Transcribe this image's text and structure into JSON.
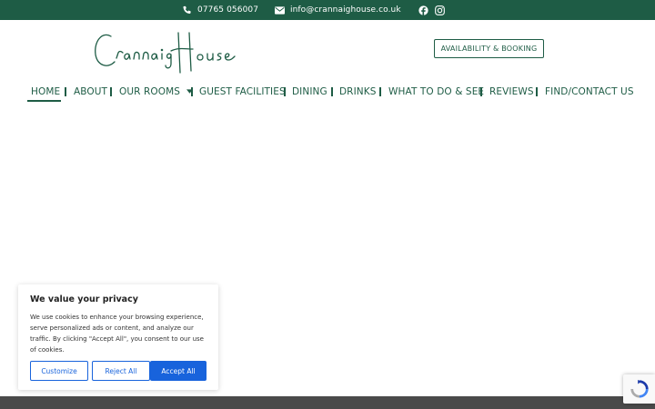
{
  "topbar": {
    "phone": "07765 056007",
    "email": "info@crannaighouse.co.uk",
    "icons": [
      "phone-icon",
      "envelope-icon",
      "facebook-icon",
      "instagram-icon"
    ]
  },
  "header": {
    "logo_text": "Crannaig House",
    "cta_label": "AVAILABILITY & BOOKING"
  },
  "nav": {
    "items": [
      {
        "label": "HOME"
      },
      {
        "label": "ABOUT"
      },
      {
        "label": "OUR ROOMS"
      },
      {
        "label": "GUEST FACILITIES"
      },
      {
        "label": "DINING"
      },
      {
        "label": "DRINKS"
      },
      {
        "label": "WHAT TO DO & SEE"
      },
      {
        "label": "REVIEWS"
      },
      {
        "label": "FIND/CONTACT US"
      }
    ]
  },
  "cookie": {
    "title": "We value your privacy",
    "body": "We use cookies to enhance your browsing experience, serve personalized ads or content, and analyze our traffic. By clicking \"Accept All\", you consent to our use of cookies.",
    "customize": "Customize",
    "reject": "Reject All",
    "accept": "Accept All"
  },
  "colors": {
    "brand_green": "#1e5c45",
    "cookie_blue": "#1863dc",
    "footer_gray": "#4a4a4a"
  }
}
